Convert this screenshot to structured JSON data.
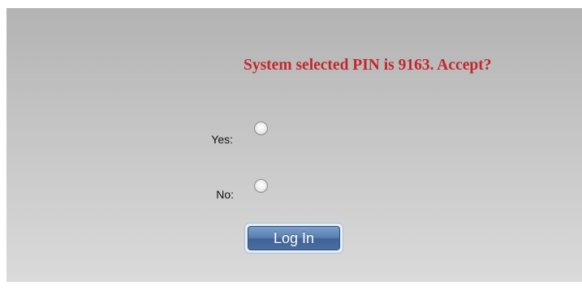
{
  "prompt": {
    "text": "System selected PIN is 9163. Accept?",
    "color": "#c2272d"
  },
  "options": {
    "yes_label": "Yes:",
    "no_label": "No:",
    "selected": null
  },
  "login_button": {
    "label": "Log In",
    "color": "#4a6ea1"
  }
}
